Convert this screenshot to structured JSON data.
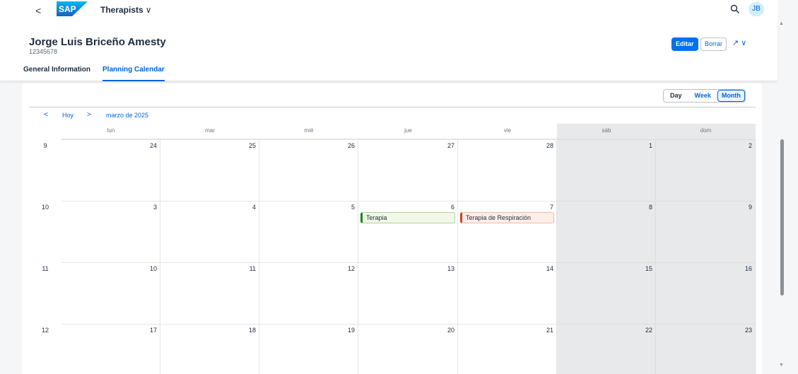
{
  "shell": {
    "back_label": "<",
    "logo_text": "SAP",
    "app_title": "Therapists",
    "title_chevron": "∨",
    "avatar_initials": "JB"
  },
  "header": {
    "name": "Jorge Luis Briceño Amesty",
    "id": "12345678",
    "edit_label": "Editar",
    "delete_label": "Borrar",
    "share_label": "↗ ∨"
  },
  "tabs": [
    {
      "label": "General Information"
    },
    {
      "label": "Planning Calendar"
    }
  ],
  "calendar": {
    "views": [
      "Day",
      "Week",
      "Month"
    ],
    "active_view": "Month",
    "nav": {
      "prev": "<",
      "today": "Hoy",
      "next": ">",
      "month_label": "marzo de 2025"
    },
    "weekdays": [
      "lun",
      "mar",
      "mié",
      "jue",
      "vie",
      "sáb",
      "dom"
    ],
    "weeks": [
      {
        "num": "9",
        "days": [
          "24",
          "25",
          "26",
          "27",
          "28",
          "1",
          "2"
        ]
      },
      {
        "num": "10",
        "days": [
          "3",
          "4",
          "5",
          "6",
          "7",
          "8",
          "9"
        ]
      },
      {
        "num": "11",
        "days": [
          "10",
          "11",
          "12",
          "13",
          "14",
          "15",
          "16"
        ]
      },
      {
        "num": "12",
        "days": [
          "17",
          "18",
          "19",
          "20",
          "21",
          "22",
          "23"
        ]
      }
    ],
    "appointments": [
      {
        "week": 1,
        "day": 3,
        "title": "Terapia",
        "color": "#188918"
      },
      {
        "week": 1,
        "day": 4,
        "title": "Terapia de Respiración",
        "color": "#d53f26"
      }
    ]
  },
  "colors": {
    "accent": "#0064d9",
    "brand": "#0070f2",
    "weekend_bg": "#e8e9ea"
  }
}
